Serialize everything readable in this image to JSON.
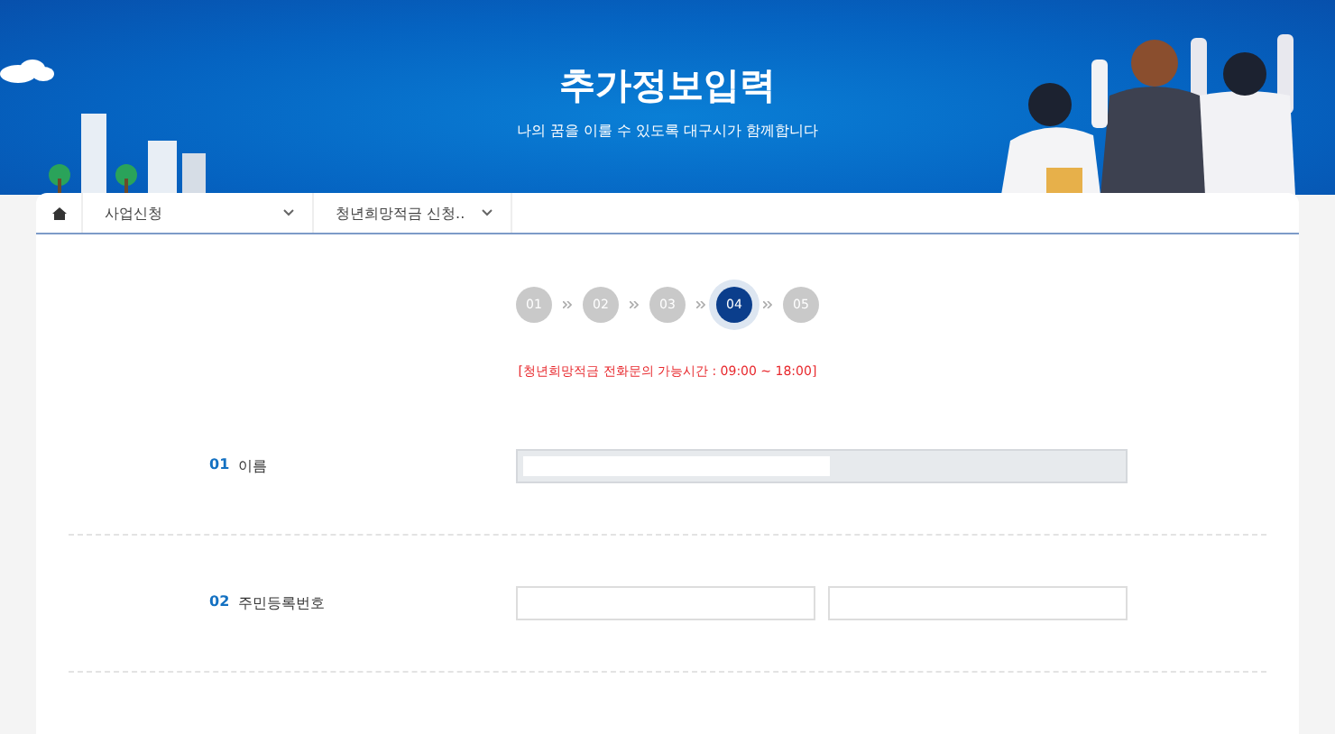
{
  "banner": {
    "title": "추가정보입력",
    "subtitle": "나의 꿈을 이룰 수 있도록 대구시가 함께합니다"
  },
  "breadcrumb": [
    {
      "label": "사업신청"
    },
    {
      "label": "청년희망적금 신청.."
    }
  ],
  "steps": [
    {
      "label": "01",
      "selected": false
    },
    {
      "label": "02",
      "selected": false
    },
    {
      "label": "03",
      "selected": false
    },
    {
      "label": "04",
      "selected": true
    },
    {
      "label": "05",
      "selected": false
    }
  ],
  "notice": "[청년희망적금 전화문의 가능시간 : 09:00 ~ 18:00]",
  "fields": [
    {
      "number": "01",
      "label": "이름",
      "inputs": [
        {
          "disabled": true,
          "redacted": true
        }
      ]
    },
    {
      "number": "02",
      "label": "주민등록번호",
      "inputs": [
        {
          "disabled": false,
          "redacted": false
        },
        {
          "disabled": false,
          "redacted": false
        }
      ]
    }
  ]
}
